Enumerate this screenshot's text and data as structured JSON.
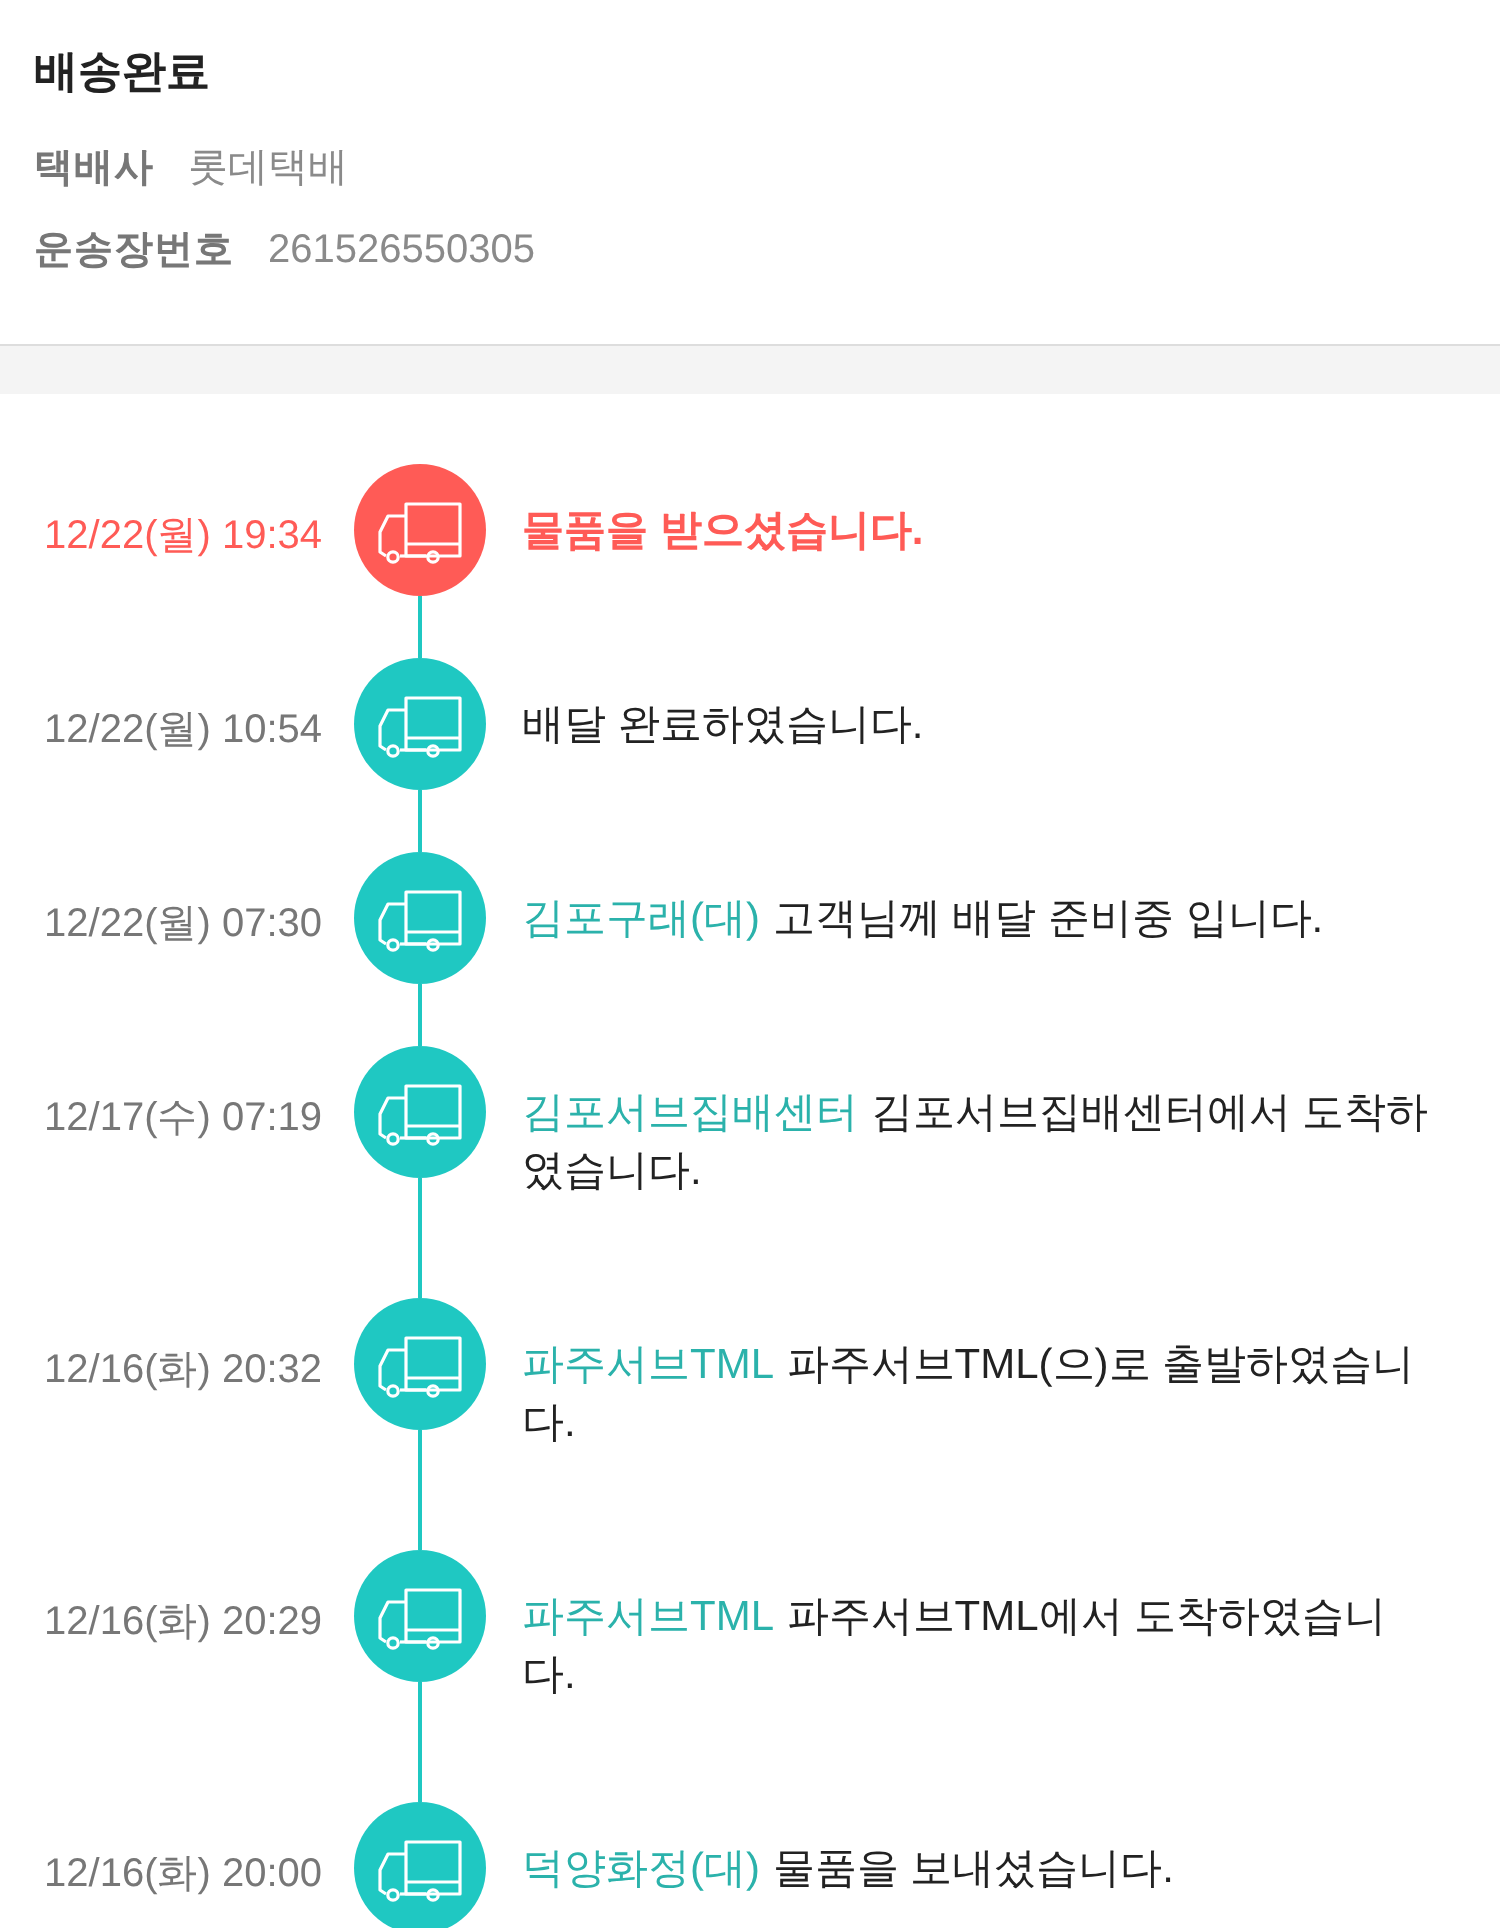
{
  "header": {
    "title": "배송완료",
    "fields": [
      {
        "label": "택배사",
        "value": "롯데택배"
      },
      {
        "label": "운송장번호",
        "value": "261526550305"
      }
    ]
  },
  "events": [
    {
      "time": "12/22(월) 19:34",
      "message": "물품을 받으셨습니다.",
      "latest": true
    },
    {
      "time": "12/22(월) 10:54",
      "message": "배달 완료하였습니다.",
      "latest": false
    },
    {
      "time": "12/22(월) 07:30",
      "location": "김포구래(대)",
      "message": "고객님께 배달 준비중 입니다.",
      "latest": false
    },
    {
      "time": "12/17(수) 07:19",
      "location": "김포서브집배센터",
      "message": "김포서브집배센터에서 도착하였습니다.",
      "latest": false
    },
    {
      "time": "12/16(화) 20:32",
      "location": "파주서브TML",
      "message": "파주서브TML(으)로 출발하였습니다.",
      "latest": false
    },
    {
      "time": "12/16(화) 20:29",
      "location": "파주서브TML",
      "message": "파주서브TML에서 도착하였습니다.",
      "latest": false
    },
    {
      "time": "12/16(화) 20:00",
      "location": "덕양화정(대)",
      "message": "물품을 보내셨습니다.",
      "latest": false
    }
  ]
}
